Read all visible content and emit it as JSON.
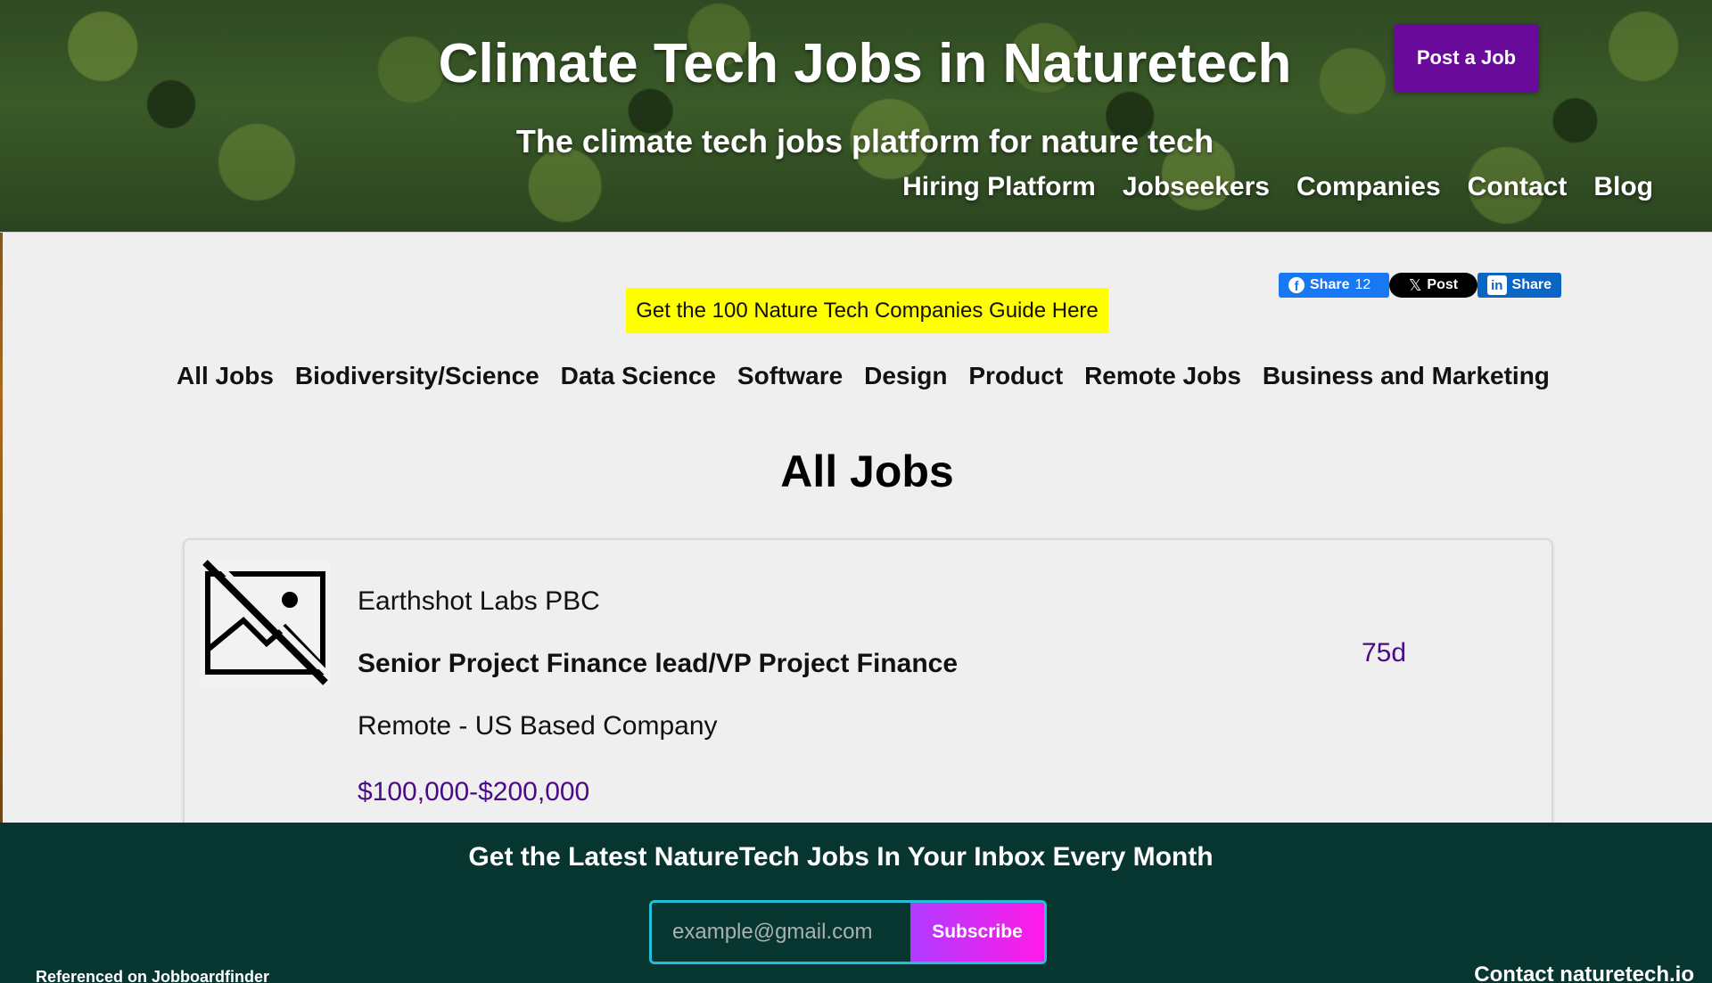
{
  "hero": {
    "title": "Climate Tech Jobs in Naturetech",
    "subtitle": "The climate tech jobs platform for nature tech",
    "post_job_label": "Post a Job",
    "nav": [
      "Hiring Platform",
      "Jobseekers",
      "Companies",
      "Contact",
      "Blog"
    ]
  },
  "share": {
    "facebook_label": "Share",
    "facebook_count": "12",
    "x_label": "Post",
    "linkedin_label": "Share",
    "facebook_color": "#1877f2",
    "linkedin_color": "#0a66c2"
  },
  "guide_banner": "Get the 100 Nature Tech Companies Guide Here",
  "categories": [
    "All Jobs",
    "Biodiversity/Science",
    "Data Science",
    "Software",
    "Design",
    "Product",
    "Remote Jobs",
    "Business and Marketing"
  ],
  "section_title": "All Jobs",
  "jobs": [
    {
      "company": "Earthshot Labs PBC",
      "title": "Senior Project Finance lead/VP Project Finance",
      "location": "Remote - US Based Company",
      "salary": "$100,000-$200,000",
      "age": "75d",
      "logo_icon": "image-missing-icon"
    }
  ],
  "footer": {
    "title": "Get the Latest NatureTech Jobs In Your Inbox Every Month",
    "email_placeholder": "example@gmail.com",
    "subscribe_label": "Subscribe",
    "referenced": "Referenced on Jobboardfinder",
    "contact": "Contact naturetech.io"
  },
  "colors": {
    "accent_purple": "#6a0a9a",
    "banner_yellow": "#ffff00",
    "footer_bg": "#073530",
    "salary_color": "#4b0a86"
  }
}
